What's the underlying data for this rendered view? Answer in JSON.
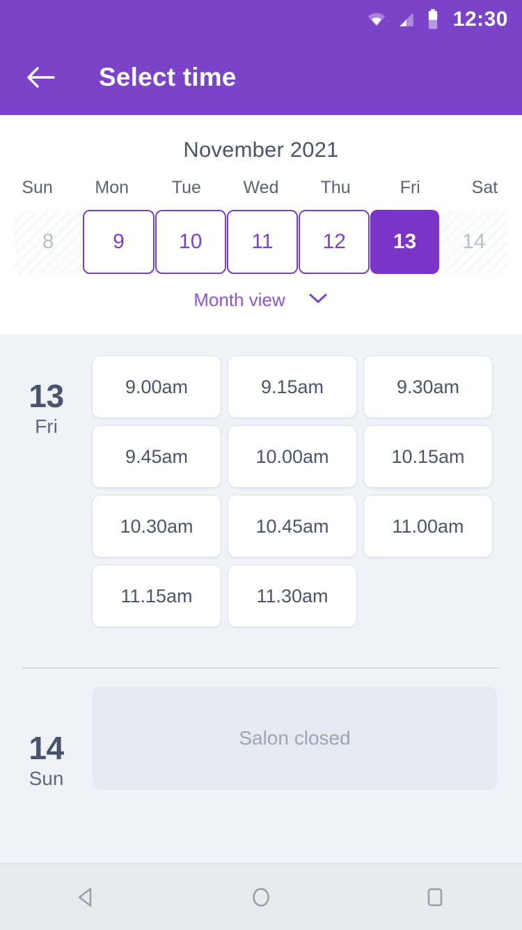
{
  "statusbar": {
    "time": "12:30",
    "icons": [
      "wifi-icon",
      "cellular-signal-icon",
      "battery-icon"
    ]
  },
  "appbar": {
    "back_icon": "arrow-left-icon",
    "title": "Select time"
  },
  "calendar": {
    "title": "November 2021",
    "weekdays": [
      "Sun",
      "Mon",
      "Tue",
      "Wed",
      "Thu",
      "Fri",
      "Sat"
    ],
    "days": [
      {
        "label": "8",
        "state": "disabled"
      },
      {
        "label": "9",
        "state": "available"
      },
      {
        "label": "10",
        "state": "available"
      },
      {
        "label": "11",
        "state": "available"
      },
      {
        "label": "12",
        "state": "available"
      },
      {
        "label": "13",
        "state": "selected"
      },
      {
        "label": "14",
        "state": "disabled"
      }
    ],
    "month_view_label": "Month view",
    "month_view_icon": "chevron-down-icon"
  },
  "schedule": [
    {
      "day_number": "13",
      "day_of_week": "Fri",
      "status": "open",
      "slots": [
        "9.00am",
        "9.15am",
        "9.30am",
        "9.45am",
        "10.00am",
        "10.15am",
        "10.30am",
        "10.45am",
        "11.00am",
        "11.15am",
        "11.30am"
      ]
    },
    {
      "day_number": "14",
      "day_of_week": "Sun",
      "status": "closed",
      "closed_label": "Salon closed",
      "slots": []
    }
  ],
  "navbar": {
    "back_icon": "android-back-triangle-icon",
    "home_icon": "android-home-circle-icon",
    "recents_icon": "android-recents-square-icon"
  },
  "colors": {
    "brand_purple": "#7B43C8",
    "selected_purple": "#7B35C6",
    "link_purple": "#8B55CF",
    "page_bg": "#EFF2F7",
    "text_dark": "#4A5568",
    "text_muted": "#9AA5B8",
    "disabled_day": "#B8C0CC"
  }
}
